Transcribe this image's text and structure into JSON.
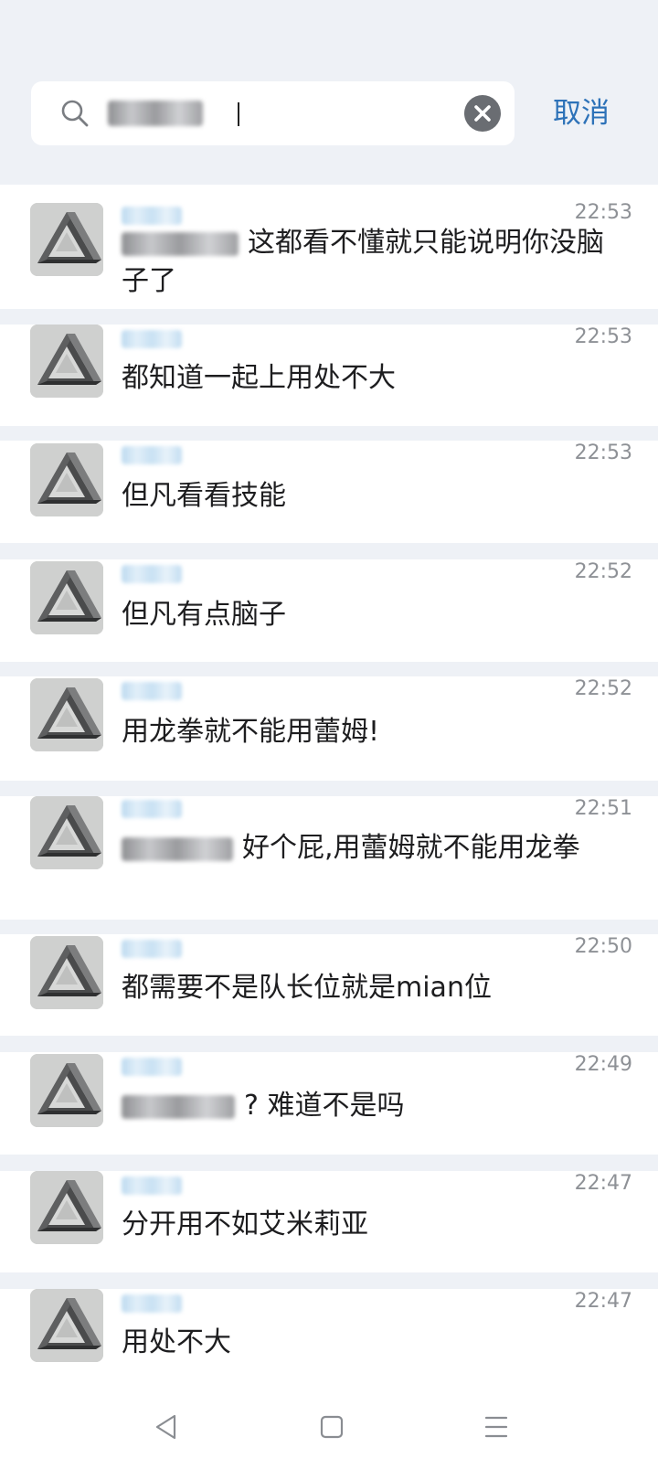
{
  "search": {
    "query_visible_suffix": "",
    "cancel_label": "取消"
  },
  "results": [
    {
      "time": "22:53",
      "message": "这都看不懂就只能说明你没脑子了",
      "has_mention": true
    },
    {
      "time": "22:53",
      "message": "都知道一起上用处不大",
      "has_mention": false
    },
    {
      "time": "22:53",
      "message": "但凡看看技能",
      "has_mention": false
    },
    {
      "time": "22:52",
      "message": "但凡有点脑子",
      "has_mention": false
    },
    {
      "time": "22:52",
      "message": "用龙拳就不能用蕾姆!",
      "has_mention": false
    },
    {
      "time": "22:51",
      "message": "好个屁,用蕾姆就不能用龙拳",
      "has_mention": true
    },
    {
      "time": "22:50",
      "message": "都需要不是队长位就是mian位",
      "has_mention": false
    },
    {
      "time": "22:49",
      "message": "? 难道不是吗",
      "has_mention": true
    },
    {
      "time": "22:47",
      "message": "分开用不如艾米莉亚",
      "has_mention": false
    },
    {
      "time": "22:47",
      "message": "用处不大",
      "has_mention": false
    }
  ],
  "navbar": {
    "icons": [
      "back-triangle-icon",
      "home-square-icon",
      "menu-lines-icon"
    ]
  },
  "colors": {
    "background": "#eef1f6",
    "accent": "#2d72b8",
    "time_text": "#8e9196"
  }
}
